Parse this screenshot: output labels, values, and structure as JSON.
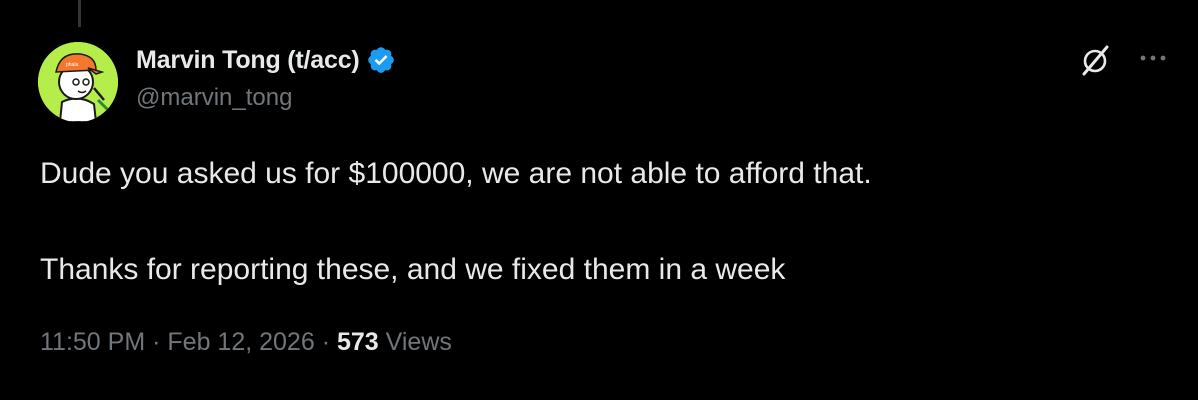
{
  "author": {
    "display_name": "Marvin Tong (t/acc)",
    "handle": "@marvin_tong",
    "verified": true,
    "avatar_hat_text": "phala",
    "avatar_icon": "cartoon-character-avatar"
  },
  "tweet": {
    "line1": "Dude you asked us for $100000, we are not able to afford that.",
    "line2": "Thanks for reporting these, and we fixed them in a week"
  },
  "meta": {
    "time": "11:50 PM",
    "separator": "·",
    "date": "Feb 12, 2026",
    "views_count": "573",
    "views_label": "Views"
  },
  "icons": {
    "verified": "verified-badge-icon",
    "grok": "grok-icon",
    "more": "more-options-icon"
  },
  "colors": {
    "background": "#000000",
    "text": "#e7e9ea",
    "secondary": "#71767b",
    "verified_blue": "#1d9bf0",
    "avatar_bg": "#b5ee4a",
    "hat_orange": "#f4772e"
  }
}
